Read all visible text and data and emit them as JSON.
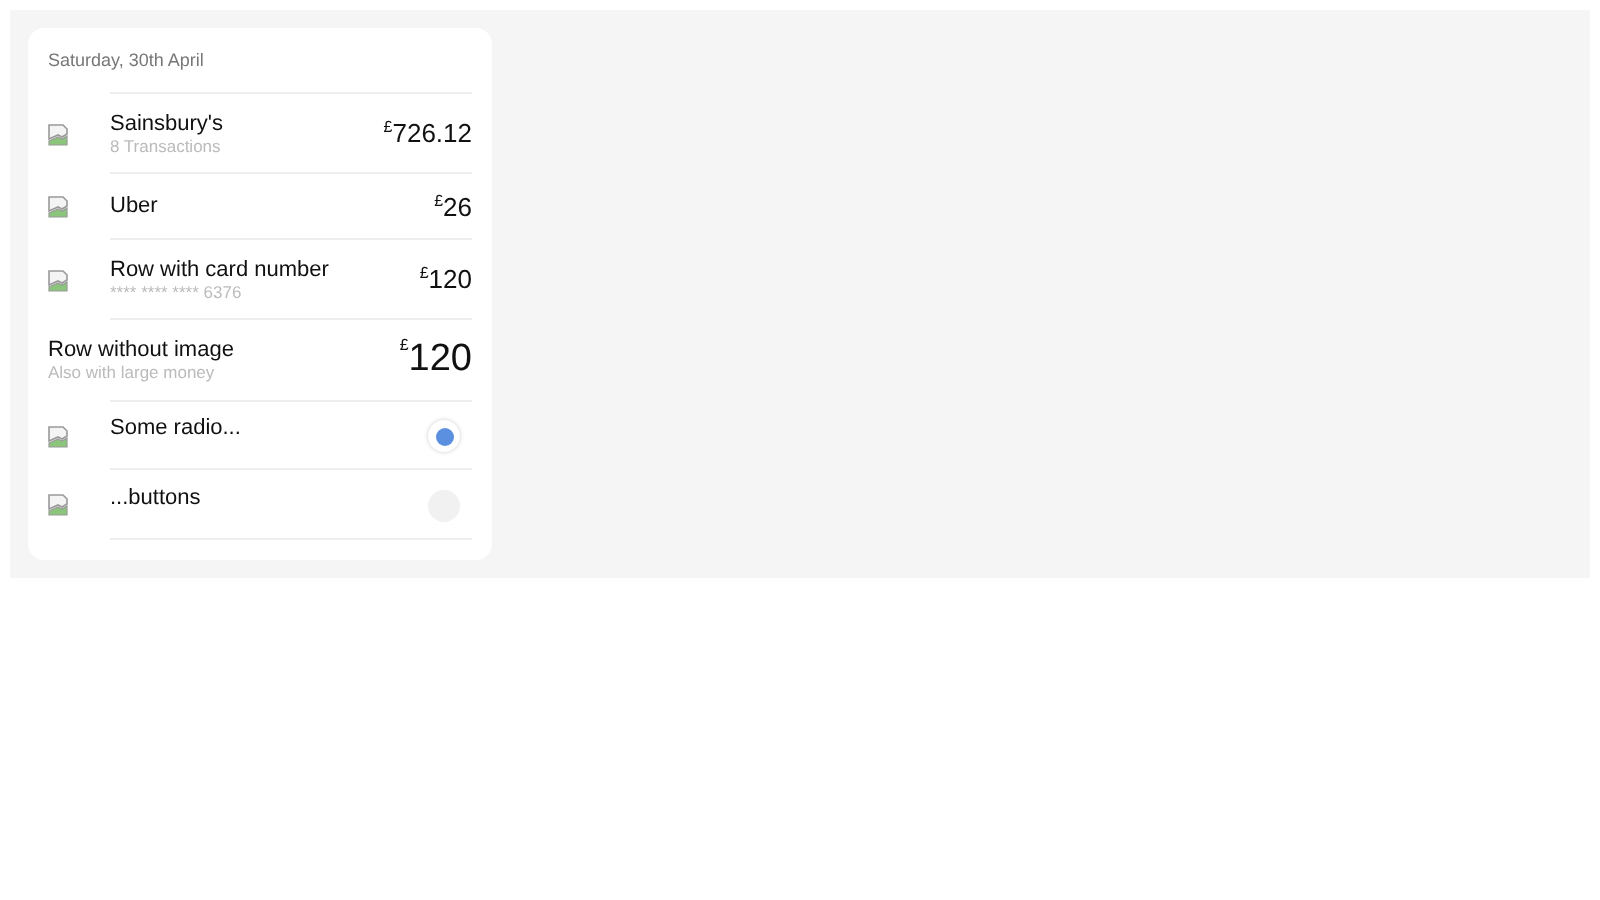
{
  "header": "Saturday, 30th April",
  "rows": [
    {
      "kind": "money",
      "image": true,
      "title": "Sainsbury's",
      "subtitle": "8 Transactions",
      "currency": "£",
      "amount": "726.12",
      "large": false
    },
    {
      "kind": "money",
      "image": true,
      "title": "Uber",
      "currency": "£",
      "amount": "26",
      "large": false
    },
    {
      "kind": "money",
      "image": true,
      "title": "Row with card number",
      "subtitle": "**** **** **** 6376",
      "currency": "£",
      "amount": "120",
      "large": false
    },
    {
      "kind": "money",
      "image": false,
      "title": "Row without image",
      "subtitle": "Also with large money",
      "currency": "£",
      "amount": "120",
      "large": true
    },
    {
      "kind": "radio",
      "image": true,
      "title": "Some radio...",
      "selected": true
    },
    {
      "kind": "radio",
      "image": true,
      "title": "...buttons",
      "selected": false
    }
  ]
}
